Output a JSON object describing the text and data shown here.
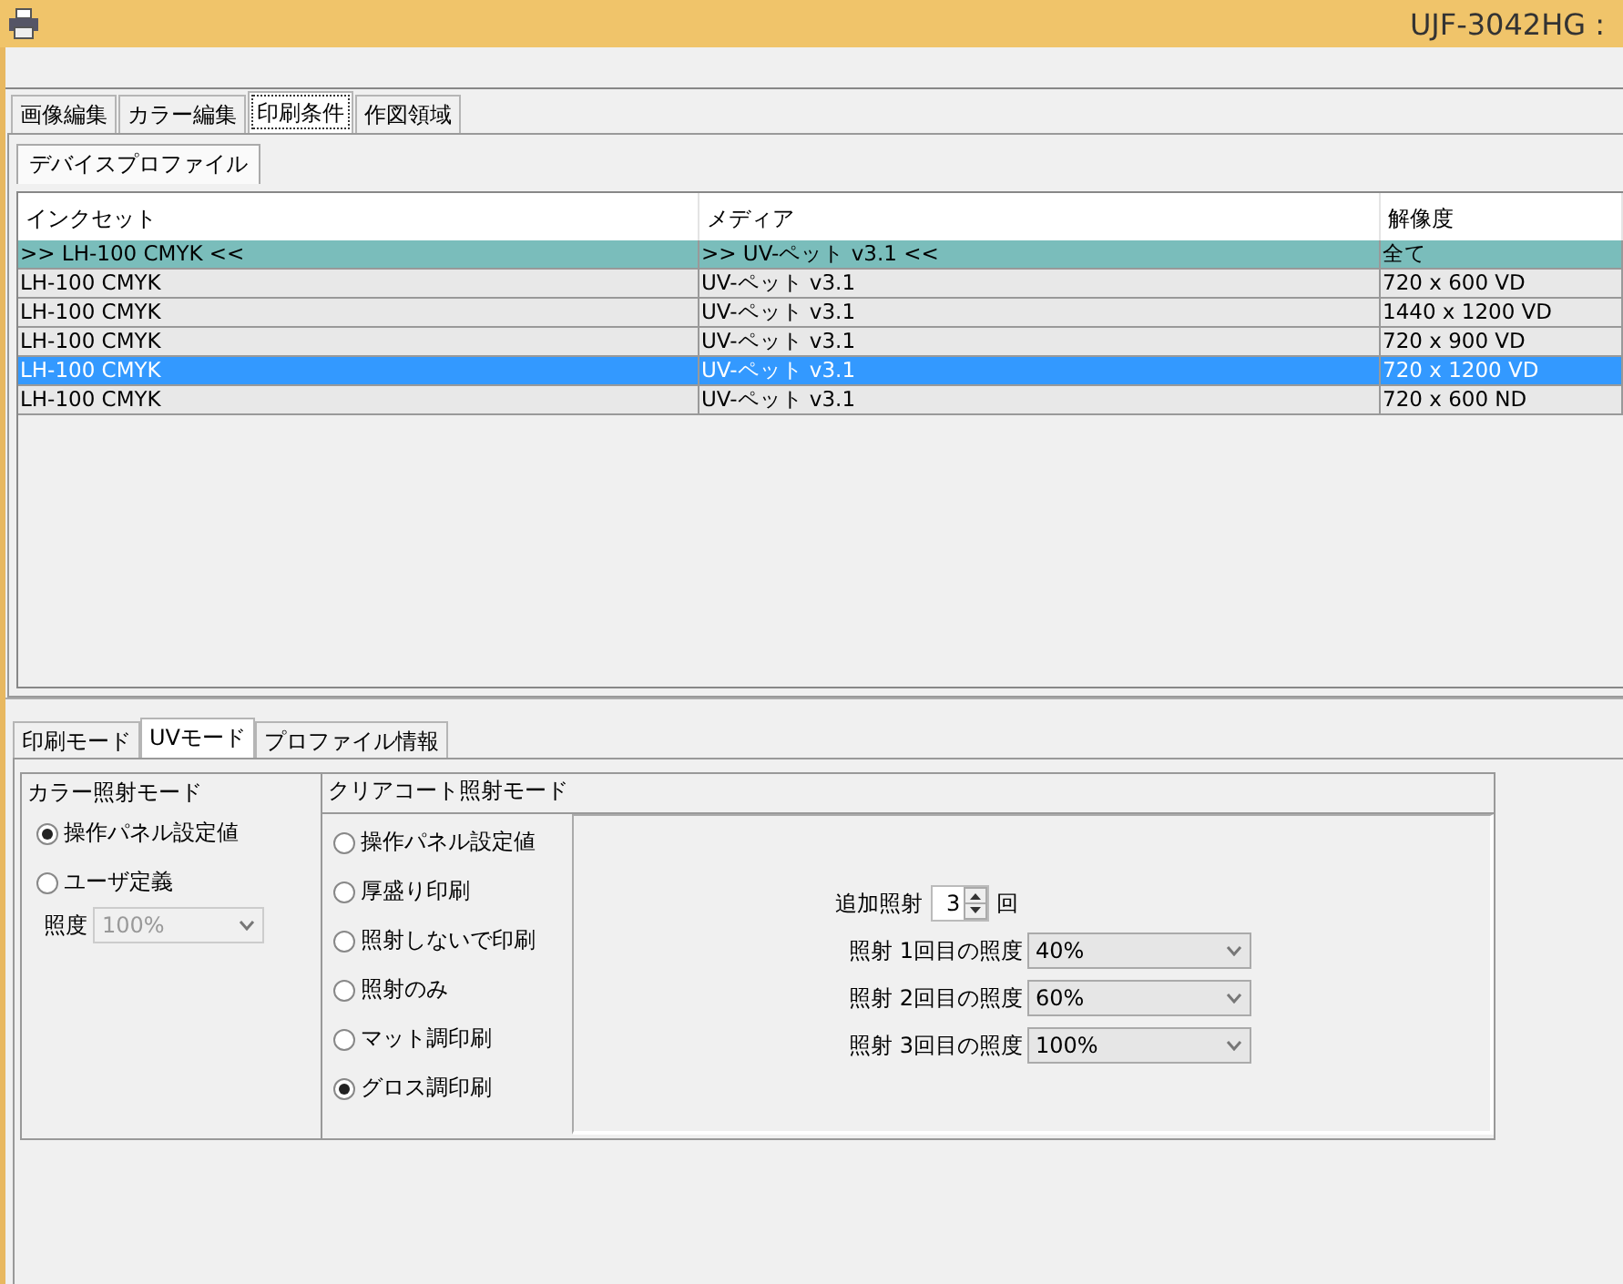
{
  "window": {
    "title": "UJF-3042HG :"
  },
  "main_tabs": [
    {
      "label": "画像編集",
      "selected": false
    },
    {
      "label": "カラー編集",
      "selected": false
    },
    {
      "label": "印刷条件",
      "selected": true
    },
    {
      "label": "作図領域",
      "selected": false
    }
  ],
  "profile_tabs": [
    {
      "label": "デバイスプロファイル",
      "selected": true
    }
  ],
  "table": {
    "columns": [
      "インクセット",
      "メディア",
      "解像度"
    ],
    "rows": [
      {
        "kind": "filter",
        "selected": false,
        "cells": [
          ">> LH-100 CMYK <<",
          ">> UV-ペット v3.1 <<",
          "全て"
        ]
      },
      {
        "kind": "item",
        "selected": false,
        "cells": [
          "LH-100 CMYK",
          "UV-ペット v3.1",
          "720 x 600 VD"
        ]
      },
      {
        "kind": "item",
        "selected": false,
        "cells": [
          "LH-100 CMYK",
          "UV-ペット v3.1",
          "1440 x 1200 VD"
        ]
      },
      {
        "kind": "item",
        "selected": false,
        "cells": [
          "LH-100 CMYK",
          "UV-ペット v3.1",
          "720 x 900 VD"
        ]
      },
      {
        "kind": "item",
        "selected": true,
        "cells": [
          "LH-100 CMYK",
          "UV-ペット v3.1",
          "720 x 1200 VD"
        ]
      },
      {
        "kind": "item",
        "selected": false,
        "cells": [
          "LH-100 CMYK",
          "UV-ペット v3.1",
          "720 x 600 ND"
        ]
      }
    ]
  },
  "settings_tabs": [
    {
      "label": "印刷モード",
      "selected": false
    },
    {
      "label": "UVモード",
      "selected": true
    },
    {
      "label": "プロファイル情報",
      "selected": false
    }
  ],
  "color_mode": {
    "title": "カラー照射モード",
    "options": [
      {
        "label": "操作パネル設定値",
        "selected": true
      },
      {
        "label": "ユーザ定義",
        "selected": false
      }
    ],
    "illuminance": {
      "label": "照度",
      "value": "100%",
      "disabled": true
    }
  },
  "clear_mode": {
    "title": "クリアコート照射モード",
    "options": [
      {
        "label": "操作パネル設定値",
        "selected": false
      },
      {
        "label": "厚盛り印刷",
        "selected": false
      },
      {
        "label": "照射しないで印刷",
        "selected": false
      },
      {
        "label": "照射のみ",
        "selected": false
      },
      {
        "label": "マット調印刷",
        "selected": false
      },
      {
        "label": "グロス調印刷",
        "selected": true
      }
    ],
    "extra": {
      "label": "追加照射",
      "value": "3",
      "unit": "回"
    },
    "passes": [
      {
        "label": "照射 1回目の照度",
        "value": "40%",
        "disabled": false
      },
      {
        "label": "照射 2回目の照度",
        "value": "60%",
        "disabled": false
      },
      {
        "label": "照射 3回目の照度",
        "value": "100%",
        "disabled": false
      }
    ]
  }
}
